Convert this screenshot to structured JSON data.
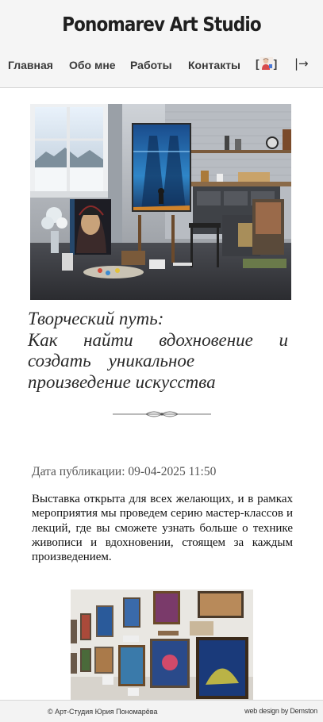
{
  "site": {
    "title": "Ponomarev Art Studio"
  },
  "nav": {
    "items": [
      {
        "label": "Главная"
      },
      {
        "label": "Обо мне"
      },
      {
        "label": "Работы"
      },
      {
        "label": "Контакты"
      }
    ],
    "user_open": "[",
    "user_close": "]",
    "login_icon": "→",
    "login_glyph": "|→"
  },
  "article": {
    "title_line1": "Творческий путь:",
    "title_line2_words": [
      "Как",
      "найти",
      "вдохновение",
      "и"
    ],
    "title_line3_words": [
      "создать",
      "уникальное"
    ],
    "title_line4": "произведение искусства",
    "pub_label": "Дата публикации:",
    "pub_value": "09-04-2025 11:50",
    "body": "Выставка открыта для всех желающих, и в рамках мероприятия мы проведем серию мастер-классов и лекций, где вы сможете узнать больше о технике живописи и вдохновении, стоящем за каждым произведением."
  },
  "footer": {
    "copyright": "© Арт-Студия Юрия Пономарёва",
    "design": "web design by Demston"
  },
  "colors": {
    "header_bg": "#f5f5f5",
    "footer_bg": "#f3f3f3",
    "nav_text": "#3a3a3a",
    "title_text": "#1f1f1f"
  }
}
